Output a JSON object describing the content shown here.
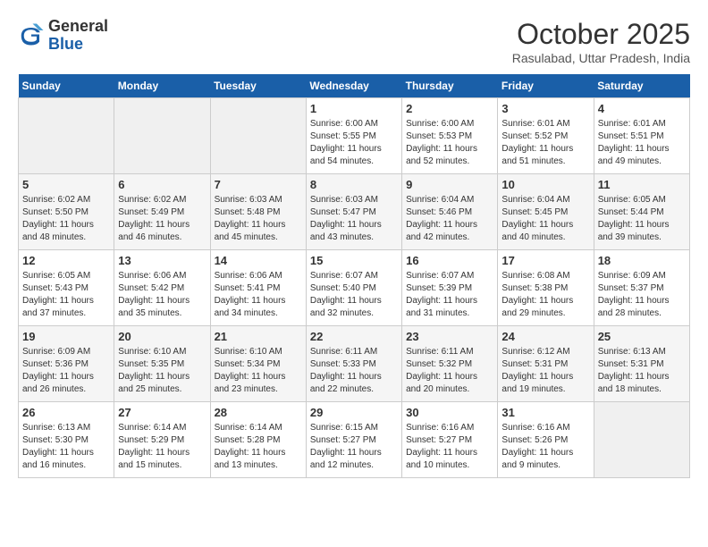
{
  "header": {
    "logo": {
      "general": "General",
      "blue": "Blue"
    },
    "title": "October 2025",
    "location": "Rasulabad, Uttar Pradesh, India"
  },
  "weekdays": [
    "Sunday",
    "Monday",
    "Tuesday",
    "Wednesday",
    "Thursday",
    "Friday",
    "Saturday"
  ],
  "weeks": [
    [
      {
        "day": "",
        "info": ""
      },
      {
        "day": "",
        "info": ""
      },
      {
        "day": "",
        "info": ""
      },
      {
        "day": "1",
        "info": "Sunrise: 6:00 AM\nSunset: 5:55 PM\nDaylight: 11 hours\nand 54 minutes."
      },
      {
        "day": "2",
        "info": "Sunrise: 6:00 AM\nSunset: 5:53 PM\nDaylight: 11 hours\nand 52 minutes."
      },
      {
        "day": "3",
        "info": "Sunrise: 6:01 AM\nSunset: 5:52 PM\nDaylight: 11 hours\nand 51 minutes."
      },
      {
        "day": "4",
        "info": "Sunrise: 6:01 AM\nSunset: 5:51 PM\nDaylight: 11 hours\nand 49 minutes."
      }
    ],
    [
      {
        "day": "5",
        "info": "Sunrise: 6:02 AM\nSunset: 5:50 PM\nDaylight: 11 hours\nand 48 minutes."
      },
      {
        "day": "6",
        "info": "Sunrise: 6:02 AM\nSunset: 5:49 PM\nDaylight: 11 hours\nand 46 minutes."
      },
      {
        "day": "7",
        "info": "Sunrise: 6:03 AM\nSunset: 5:48 PM\nDaylight: 11 hours\nand 45 minutes."
      },
      {
        "day": "8",
        "info": "Sunrise: 6:03 AM\nSunset: 5:47 PM\nDaylight: 11 hours\nand 43 minutes."
      },
      {
        "day": "9",
        "info": "Sunrise: 6:04 AM\nSunset: 5:46 PM\nDaylight: 11 hours\nand 42 minutes."
      },
      {
        "day": "10",
        "info": "Sunrise: 6:04 AM\nSunset: 5:45 PM\nDaylight: 11 hours\nand 40 minutes."
      },
      {
        "day": "11",
        "info": "Sunrise: 6:05 AM\nSunset: 5:44 PM\nDaylight: 11 hours\nand 39 minutes."
      }
    ],
    [
      {
        "day": "12",
        "info": "Sunrise: 6:05 AM\nSunset: 5:43 PM\nDaylight: 11 hours\nand 37 minutes."
      },
      {
        "day": "13",
        "info": "Sunrise: 6:06 AM\nSunset: 5:42 PM\nDaylight: 11 hours\nand 35 minutes."
      },
      {
        "day": "14",
        "info": "Sunrise: 6:06 AM\nSunset: 5:41 PM\nDaylight: 11 hours\nand 34 minutes."
      },
      {
        "day": "15",
        "info": "Sunrise: 6:07 AM\nSunset: 5:40 PM\nDaylight: 11 hours\nand 32 minutes."
      },
      {
        "day": "16",
        "info": "Sunrise: 6:07 AM\nSunset: 5:39 PM\nDaylight: 11 hours\nand 31 minutes."
      },
      {
        "day": "17",
        "info": "Sunrise: 6:08 AM\nSunset: 5:38 PM\nDaylight: 11 hours\nand 29 minutes."
      },
      {
        "day": "18",
        "info": "Sunrise: 6:09 AM\nSunset: 5:37 PM\nDaylight: 11 hours\nand 28 minutes."
      }
    ],
    [
      {
        "day": "19",
        "info": "Sunrise: 6:09 AM\nSunset: 5:36 PM\nDaylight: 11 hours\nand 26 minutes."
      },
      {
        "day": "20",
        "info": "Sunrise: 6:10 AM\nSunset: 5:35 PM\nDaylight: 11 hours\nand 25 minutes."
      },
      {
        "day": "21",
        "info": "Sunrise: 6:10 AM\nSunset: 5:34 PM\nDaylight: 11 hours\nand 23 minutes."
      },
      {
        "day": "22",
        "info": "Sunrise: 6:11 AM\nSunset: 5:33 PM\nDaylight: 11 hours\nand 22 minutes."
      },
      {
        "day": "23",
        "info": "Sunrise: 6:11 AM\nSunset: 5:32 PM\nDaylight: 11 hours\nand 20 minutes."
      },
      {
        "day": "24",
        "info": "Sunrise: 6:12 AM\nSunset: 5:31 PM\nDaylight: 11 hours\nand 19 minutes."
      },
      {
        "day": "25",
        "info": "Sunrise: 6:13 AM\nSunset: 5:31 PM\nDaylight: 11 hours\nand 18 minutes."
      }
    ],
    [
      {
        "day": "26",
        "info": "Sunrise: 6:13 AM\nSunset: 5:30 PM\nDaylight: 11 hours\nand 16 minutes."
      },
      {
        "day": "27",
        "info": "Sunrise: 6:14 AM\nSunset: 5:29 PM\nDaylight: 11 hours\nand 15 minutes."
      },
      {
        "day": "28",
        "info": "Sunrise: 6:14 AM\nSunset: 5:28 PM\nDaylight: 11 hours\nand 13 minutes."
      },
      {
        "day": "29",
        "info": "Sunrise: 6:15 AM\nSunset: 5:27 PM\nDaylight: 11 hours\nand 12 minutes."
      },
      {
        "day": "30",
        "info": "Sunrise: 6:16 AM\nSunset: 5:27 PM\nDaylight: 11 hours\nand 10 minutes."
      },
      {
        "day": "31",
        "info": "Sunrise: 6:16 AM\nSunset: 5:26 PM\nDaylight: 11 hours\nand 9 minutes."
      },
      {
        "day": "",
        "info": ""
      }
    ]
  ]
}
